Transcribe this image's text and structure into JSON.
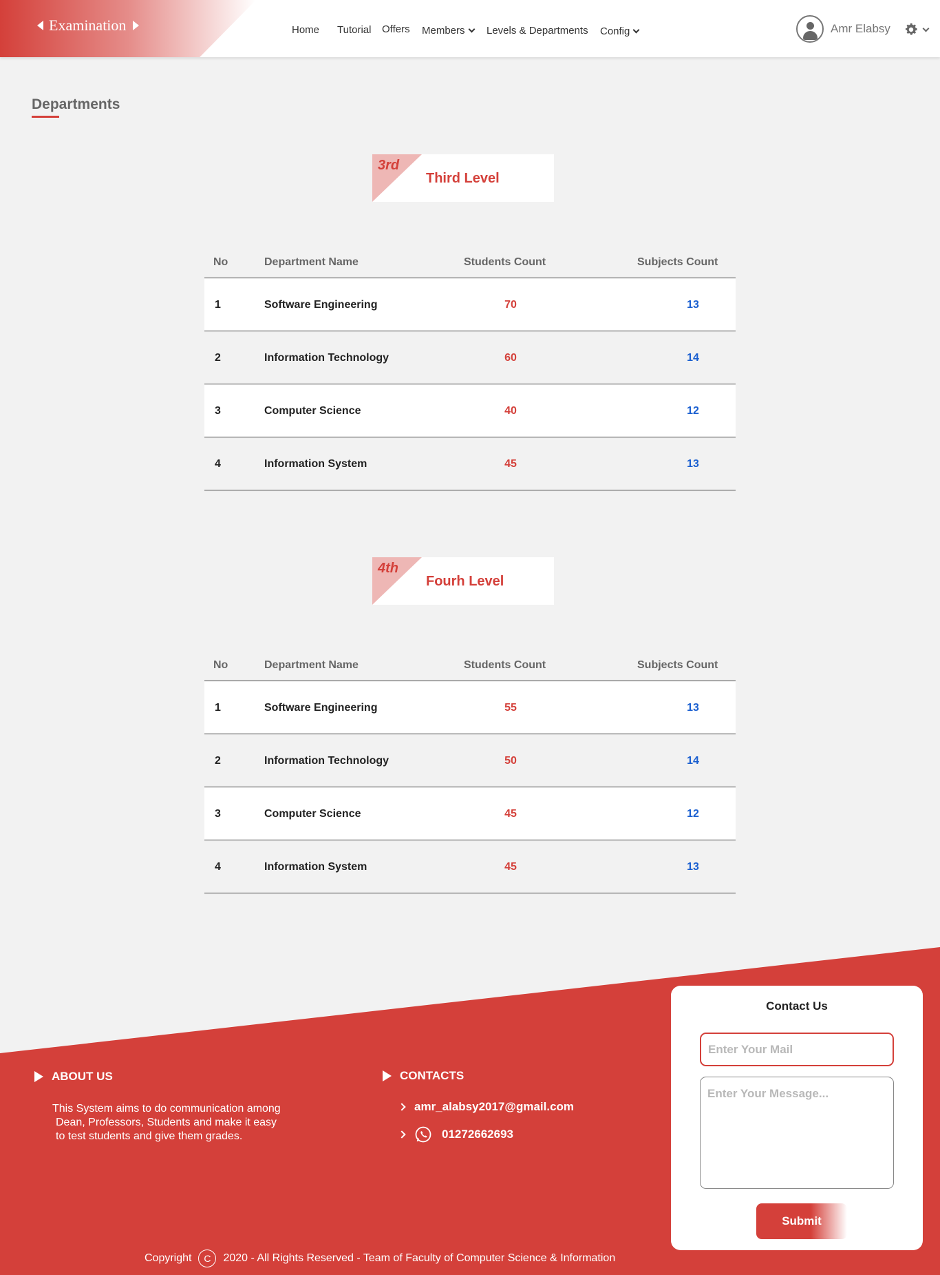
{
  "header": {
    "logo_text": "Examination",
    "nav": [
      {
        "label": "Home"
      },
      {
        "label": "Tutorial"
      },
      {
        "label": "Offers"
      },
      {
        "label": "Members"
      },
      {
        "label": "Levels & Departments"
      },
      {
        "label": "Config"
      }
    ],
    "user_name": "Amr Elabsy"
  },
  "page": {
    "title": "Departments"
  },
  "table_headers": {
    "no": "No",
    "name": "Department Name",
    "students": "Students Count",
    "subjects": "Subjects Count"
  },
  "levels": [
    {
      "ordinal": "3rd",
      "name": "Third Level",
      "rows": [
        {
          "no": "1",
          "name": "Software Engineering",
          "students": "70",
          "subjects": "13"
        },
        {
          "no": "2",
          "name": "Information Technology",
          "students": "60",
          "subjects": "14"
        },
        {
          "no": "3",
          "name": "Computer Science",
          "students": "40",
          "subjects": "12"
        },
        {
          "no": "4",
          "name": "Information System",
          "students": "45",
          "subjects": "13"
        }
      ]
    },
    {
      "ordinal": "4th",
      "name": "Fourh Level",
      "rows": [
        {
          "no": "1",
          "name": "Software Engineering",
          "students": "55",
          "subjects": "13"
        },
        {
          "no": "2",
          "name": "Information Technology",
          "students": "50",
          "subjects": "14"
        },
        {
          "no": "3",
          "name": "Computer Science",
          "students": "45",
          "subjects": "12"
        },
        {
          "no": "4",
          "name": "Information System",
          "students": "45",
          "subjects": "13"
        }
      ]
    }
  ],
  "footer": {
    "about_title": "ABOUT US",
    "about_lines": [
      "This System aims to do communication among",
      "Dean, Professors, Students and make it easy",
      "to test students and give them grades."
    ],
    "contacts_title": "CONTACTS",
    "email": "amr_alabsy2017@gmail.com",
    "phone": "01272662693",
    "copyright_prefix": "Copyright",
    "copyright_text": "2020 - All Rights Reserved - Team of Faculty of Computer Science & Information"
  },
  "contact_form": {
    "title": "Contact Us",
    "mail_placeholder": "Enter Your Mail",
    "message_placeholder": "Enter Your Message...",
    "submit_label": "Submit"
  },
  "colors": {
    "accent": "#d4403a",
    "subjects_blue": "#1a5fd0",
    "background": "#f2f2f2"
  }
}
